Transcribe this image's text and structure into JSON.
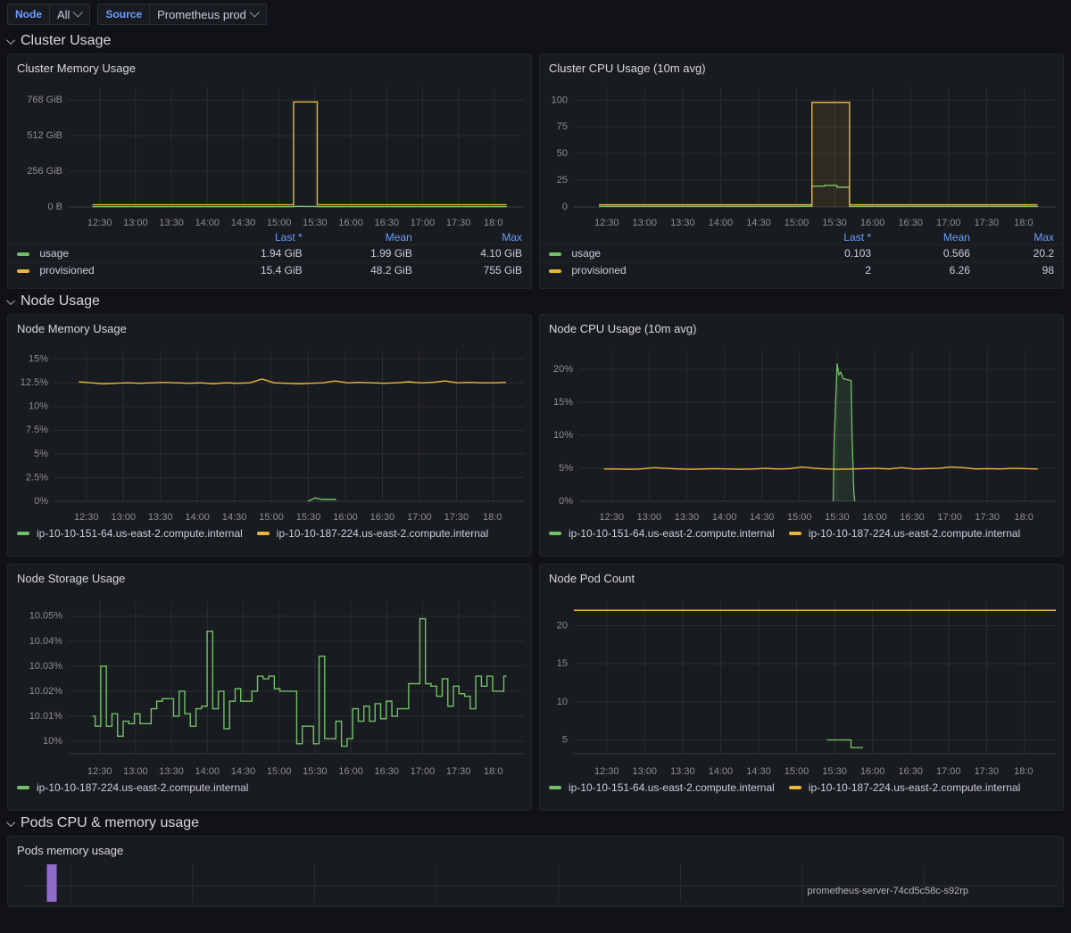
{
  "toolbar": {
    "variables": [
      {
        "label": "Node",
        "value": "All",
        "has_caret": true
      },
      {
        "label": "Source",
        "value": "Prometheus prod",
        "has_caret": true
      }
    ]
  },
  "rows": [
    {
      "title": "Cluster Usage"
    },
    {
      "title": "Node Usage"
    },
    {
      "title": "Pods CPU & memory usage"
    }
  ],
  "colors": {
    "green": "#73bf69",
    "yellow": "#eab839",
    "purple": "#8f6bcc",
    "accent_blue": "#6e9fff",
    "panel_bg": "#181b1f",
    "page_bg": "#111217",
    "grid": "#2c2d31",
    "axis_text": "#8e8e93"
  },
  "panels": {
    "cluster_memory": {
      "title": "Cluster Memory Usage",
      "legend_headers": [
        "Last *",
        "Mean",
        "Max"
      ],
      "series": [
        {
          "name": "usage",
          "color": "#73bf69",
          "last": "1.94 GiB",
          "mean": "1.99 GiB",
          "max": "4.10 GiB"
        },
        {
          "name": "provisioned",
          "color": "#eab839",
          "last": "15.4 GiB",
          "mean": "48.2 GiB",
          "max": "755 GiB"
        }
      ]
    },
    "cluster_cpu": {
      "title": "Cluster CPU Usage (10m avg)",
      "legend_headers": [
        "Last *",
        "Mean",
        "Max"
      ],
      "series": [
        {
          "name": "usage",
          "color": "#73bf69",
          "last": "0.103",
          "mean": "0.566",
          "max": "20.2"
        },
        {
          "name": "provisioned",
          "color": "#eab839",
          "last": "2",
          "mean": "6.26",
          "max": "98"
        }
      ]
    },
    "node_memory": {
      "title": "Node Memory Usage",
      "series": [
        {
          "name": "ip-10-10-151-64.us-east-2.compute.internal",
          "color": "#73bf69"
        },
        {
          "name": "ip-10-10-187-224.us-east-2.compute.internal",
          "color": "#eab839"
        }
      ]
    },
    "node_cpu": {
      "title": "Node CPU Usage (10m avg)",
      "series": [
        {
          "name": "ip-10-10-151-64.us-east-2.compute.internal",
          "color": "#73bf69"
        },
        {
          "name": "ip-10-10-187-224.us-east-2.compute.internal",
          "color": "#eab839"
        }
      ]
    },
    "node_storage": {
      "title": "Node Storage Usage",
      "series": [
        {
          "name": "ip-10-10-187-224.us-east-2.compute.internal",
          "color": "#73bf69"
        }
      ]
    },
    "node_pods": {
      "title": "Node Pod Count",
      "series": [
        {
          "name": "ip-10-10-151-64.us-east-2.compute.internal",
          "color": "#73bf69"
        },
        {
          "name": "ip-10-10-187-224.us-east-2.compute.internal",
          "color": "#eab839"
        }
      ]
    },
    "pods_memory": {
      "title": "Pods memory usage",
      "annotation": "prometheus-server-74cd5c58c-s92rp"
    }
  },
  "chart_data": [
    {
      "id": "cluster_memory",
      "type": "line",
      "title": "Cluster Memory Usage",
      "xlabel": "",
      "ylabel": "",
      "ylim": [
        0,
        860
      ],
      "yticks": [
        0,
        256,
        512,
        768
      ],
      "ytick_labels": [
        "0 B",
        "256 GiB",
        "512 GiB",
        "768 GiB"
      ],
      "xticks": [
        "12:30",
        "13:00",
        "13:30",
        "14:00",
        "14:30",
        "15:00",
        "15:30",
        "16:00",
        "16:30",
        "17:00",
        "17:30",
        "18:00"
      ],
      "grid": true,
      "legend": "table-right",
      "series": [
        {
          "name": "usage",
          "color": "#73bf69",
          "unit": "GiB",
          "values": [
            2.0,
            1.98,
            1.97,
            2.0,
            1.99,
            1.98,
            2.0,
            2.01,
            1.99,
            1.97,
            2.0,
            1.99,
            2.0,
            1.98,
            1.99,
            2.0,
            2.0,
            4.1,
            3.9,
            2.1,
            1.99,
            1.98,
            2.0,
            1.99,
            2.0,
            1.98,
            1.99,
            2.0,
            1.99,
            1.98,
            2.0,
            1.99,
            1.98,
            1.97,
            1.99,
            1.94
          ]
        },
        {
          "name": "provisioned",
          "color": "#eab839",
          "unit": "GiB",
          "values": [
            15.4,
            15.4,
            15.4,
            15.4,
            15.4,
            15.4,
            15.4,
            15.4,
            15.4,
            15.4,
            15.4,
            15.4,
            15.4,
            15.4,
            15.4,
            15.4,
            15.4,
            755,
            755,
            15.4,
            15.4,
            15.4,
            15.4,
            15.4,
            15.4,
            15.4,
            15.4,
            15.4,
            15.4,
            15.4,
            15.4,
            15.4,
            15.4,
            15.4,
            15.4,
            15.4
          ]
        }
      ]
    },
    {
      "id": "cluster_cpu",
      "type": "line",
      "title": "Cluster CPU Usage (10m avg)",
      "ylim": [
        0,
        112
      ],
      "yticks": [
        0,
        25,
        50,
        75,
        100
      ],
      "ytick_labels": [
        "0",
        "25",
        "50",
        "75",
        "100"
      ],
      "xticks": [
        "12:30",
        "13:00",
        "13:30",
        "14:00",
        "14:30",
        "15:00",
        "15:30",
        "16:00",
        "16:30",
        "17:00",
        "17:30",
        "18:00"
      ],
      "grid": true,
      "legend": "table-right",
      "series": [
        {
          "name": "usage",
          "color": "#73bf69",
          "values": [
            0.5,
            0.5,
            0.5,
            0.5,
            0.5,
            0.5,
            0.5,
            0.5,
            0.5,
            0.5,
            0.5,
            0.5,
            0.5,
            0.5,
            0.5,
            0.5,
            0.6,
            19.5,
            20.2,
            18.5,
            0.5,
            0.5,
            0.5,
            0.5,
            0.5,
            0.5,
            0.5,
            0.5,
            0.5,
            0.5,
            0.5,
            0.5,
            0.5,
            0.5,
            0.5,
            0.103
          ]
        },
        {
          "name": "provisioned",
          "color": "#eab839",
          "values": [
            2,
            2,
            2,
            2,
            2,
            2,
            2,
            2,
            2,
            2,
            2,
            2,
            2,
            2,
            2,
            2,
            2,
            98,
            98,
            98,
            2,
            2,
            2,
            2,
            2,
            2,
            2,
            2,
            2,
            2,
            2,
            2,
            2,
            2,
            2,
            2
          ]
        }
      ]
    },
    {
      "id": "node_memory",
      "type": "line",
      "title": "Node Memory Usage",
      "ylim": [
        0,
        16
      ],
      "yticks": [
        0,
        2.5,
        5,
        7.5,
        10,
        12.5,
        15
      ],
      "ytick_labels": [
        "0%",
        "2.5%",
        "5%",
        "7.5%",
        "10%",
        "12.5%",
        "15%"
      ],
      "xticks": [
        "12:30",
        "13:00",
        "13:30",
        "14:00",
        "14:30",
        "15:00",
        "15:30",
        "16:00",
        "16:30",
        "17:00",
        "17:30",
        "18:00"
      ],
      "grid": true,
      "legend": "inline-bottom",
      "series": [
        {
          "name": "ip-10-10-151-64.us-east-2.compute.internal",
          "color": "#73bf69",
          "segment_x": [
            0.54,
            0.6
          ],
          "values": [
            0.0,
            0.35,
            0.2,
            0.2,
            0.2
          ]
        },
        {
          "name": "ip-10-10-187-224.us-east-2.compute.internal",
          "color": "#eab839",
          "values": [
            12.6,
            12.5,
            12.4,
            12.45,
            12.5,
            12.45,
            12.5,
            12.55,
            12.5,
            12.45,
            12.5,
            12.4,
            12.5,
            12.45,
            12.5,
            12.9,
            12.5,
            12.45,
            12.4,
            12.45,
            12.5,
            12.7,
            12.5,
            12.55,
            12.5,
            12.45,
            12.5,
            12.6,
            12.5,
            12.55,
            12.7,
            12.5,
            12.55,
            12.5,
            12.5,
            12.55
          ]
        }
      ]
    },
    {
      "id": "node_cpu",
      "type": "line",
      "title": "Node CPU Usage (10m avg)",
      "ylim": [
        0,
        23
      ],
      "yticks": [
        0,
        5,
        10,
        15,
        20
      ],
      "ytick_labels": [
        "0%",
        "5%",
        "10%",
        "15%",
        "20%"
      ],
      "xticks": [
        "12:30",
        "13:00",
        "13:30",
        "14:00",
        "14:30",
        "15:00",
        "15:30",
        "16:00",
        "16:30",
        "17:00",
        "17:30",
        "18:00"
      ],
      "grid": true,
      "legend": "inline-bottom",
      "series": [
        {
          "name": "ip-10-10-151-64.us-east-2.compute.internal",
          "color": "#73bf69",
          "spike": {
            "start": 0.533,
            "peak": 20.9,
            "end": 0.578
          }
        },
        {
          "name": "ip-10-10-187-224.us-east-2.compute.internal",
          "color": "#eab839",
          "values": [
            4.9,
            4.9,
            4.85,
            4.9,
            5.1,
            5.0,
            4.9,
            4.85,
            4.9,
            4.95,
            4.9,
            4.85,
            4.9,
            5.0,
            4.9,
            4.95,
            5.2,
            5.0,
            4.9,
            4.85,
            4.9,
            4.95,
            5.0,
            4.9,
            5.1,
            4.9,
            4.95,
            5.0,
            5.2,
            5.1,
            4.9,
            4.95,
            4.9,
            5.0,
            4.95,
            4.9
          ]
        }
      ]
    },
    {
      "id": "node_storage",
      "type": "line",
      "title": "Node Storage Usage",
      "ylim": [
        9.995,
        10.056
      ],
      "yticks": [
        10,
        10.01,
        10.02,
        10.03,
        10.04,
        10.05
      ],
      "ytick_labels": [
        "10%",
        "10.01%",
        "10.02%",
        "10.03%",
        "10.04%",
        "10.05%"
      ],
      "xticks": [
        "12:30",
        "13:00",
        "13:30",
        "14:00",
        "14:30",
        "15:00",
        "15:30",
        "16:00",
        "16:30",
        "17:00",
        "17:30",
        "18:00"
      ],
      "grid": true,
      "legend": "inline-bottom",
      "series": [
        {
          "name": "ip-10-10-187-224.us-east-2.compute.internal",
          "color": "#73bf69",
          "values": [
            10.01,
            10.006,
            10.03,
            10.006,
            10.011,
            10.002,
            10.008,
            10.007,
            10.011,
            10.007,
            10.007,
            10.013,
            10.016,
            10.017,
            10.017,
            10.01,
            10.02,
            10.011,
            10.006,
            10.013,
            10.014,
            10.044,
            10.013,
            10.02,
            10.005,
            10.016,
            10.021,
            10.016,
            10.016,
            10.02,
            10.026,
            10.025,
            10.026,
            10.021,
            10.02,
            10.02,
            10.02,
            9.999,
            10.006,
            10.006,
            9.999,
            10.034,
            10.001,
            10.001,
            10.008,
            9.998,
            10.001,
            10.013,
            10.008,
            10.014,
            10.008,
            10.015,
            10.009,
            10.016,
            10.01,
            10.013,
            10.013,
            10.023,
            10.023,
            10.049,
            10.023,
            10.022,
            10.018,
            10.025,
            10.014,
            10.022,
            10.019,
            10.018,
            10.013,
            10.026,
            10.022,
            10.026,
            10.02,
            10.02,
            10.026
          ]
        }
      ]
    },
    {
      "id": "node_pods",
      "type": "line",
      "title": "Node Pod Count",
      "ylim": [
        3.2,
        23.2
      ],
      "yticks": [
        5,
        10,
        15,
        20
      ],
      "ytick_labels": [
        "5",
        "10",
        "15",
        "20"
      ],
      "xticks": [
        "12:30",
        "13:00",
        "13:30",
        "14:00",
        "14:30",
        "15:00",
        "15:30",
        "16:00",
        "16:30",
        "17:00",
        "17:30",
        "18:00"
      ],
      "grid": true,
      "legend": "inline-bottom",
      "series": [
        {
          "name": "ip-10-10-151-64.us-east-2.compute.internal",
          "color": "#73bf69",
          "segment_x": [
            0.525,
            0.6
          ],
          "values": [
            5,
            5,
            4,
            4
          ]
        },
        {
          "name": "ip-10-10-187-224.us-east-2.compute.internal",
          "color": "#eab839",
          "constant": 22
        }
      ]
    },
    {
      "id": "pods_memory",
      "type": "bar",
      "title": "Pods memory usage",
      "annotation": "prometheus-server-74cd5c58c-s92rp",
      "bars": [
        {
          "x": 0.022,
          "color": "#8f6bcc"
        }
      ]
    }
  ]
}
